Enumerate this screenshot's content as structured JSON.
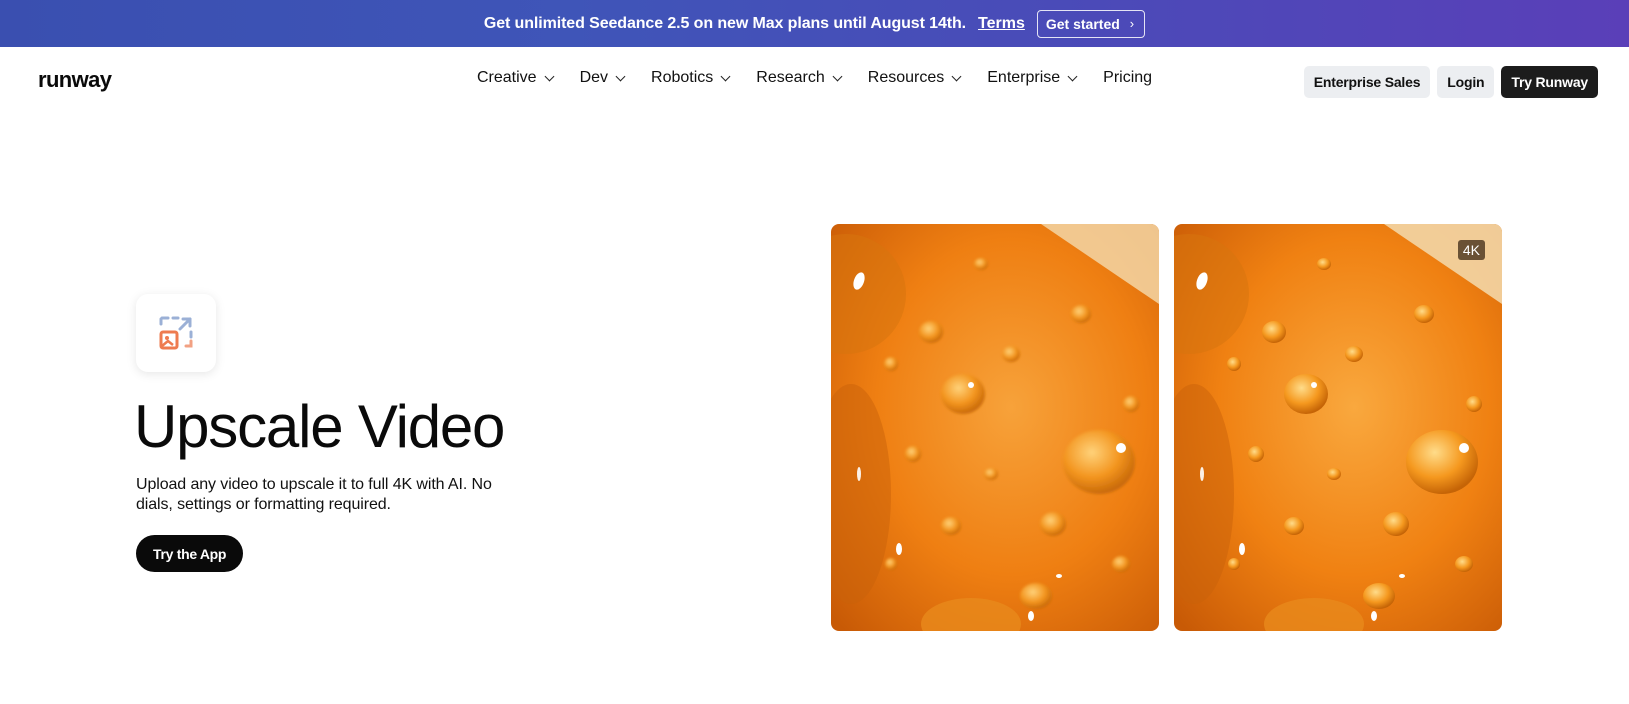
{
  "banner": {
    "text": "Get unlimited Seedance 2.5 on new Max plans until August 14th.",
    "terms_label": "Terms",
    "cta_label": "Get started"
  },
  "nav": {
    "logo": "runway",
    "menu": [
      {
        "label": "Creative",
        "has_dropdown": true
      },
      {
        "label": "Dev",
        "has_dropdown": true
      },
      {
        "label": "Robotics",
        "has_dropdown": true
      },
      {
        "label": "Research",
        "has_dropdown": true
      },
      {
        "label": "Resources",
        "has_dropdown": true
      },
      {
        "label": "Enterprise",
        "has_dropdown": true
      },
      {
        "label": "Pricing",
        "has_dropdown": false
      }
    ],
    "enterprise_sales_label": "Enterprise Sales",
    "login_label": "Login",
    "try_runway_label": "Try Runway"
  },
  "hero": {
    "icon": "upscale-image-icon",
    "title": "Upscale Video",
    "description": "Upload any video to upscale it to full 4K with AI. No dials, settings or formatting required.",
    "cta_label": "Try the App",
    "badge": "4K"
  },
  "colors": {
    "banner_start": "#3a4fb0",
    "banner_end": "#5a3fb8",
    "cta_dark": "#0a0a0a",
    "nav_light_btn": "#eceef1",
    "orange": "#f07a10"
  }
}
